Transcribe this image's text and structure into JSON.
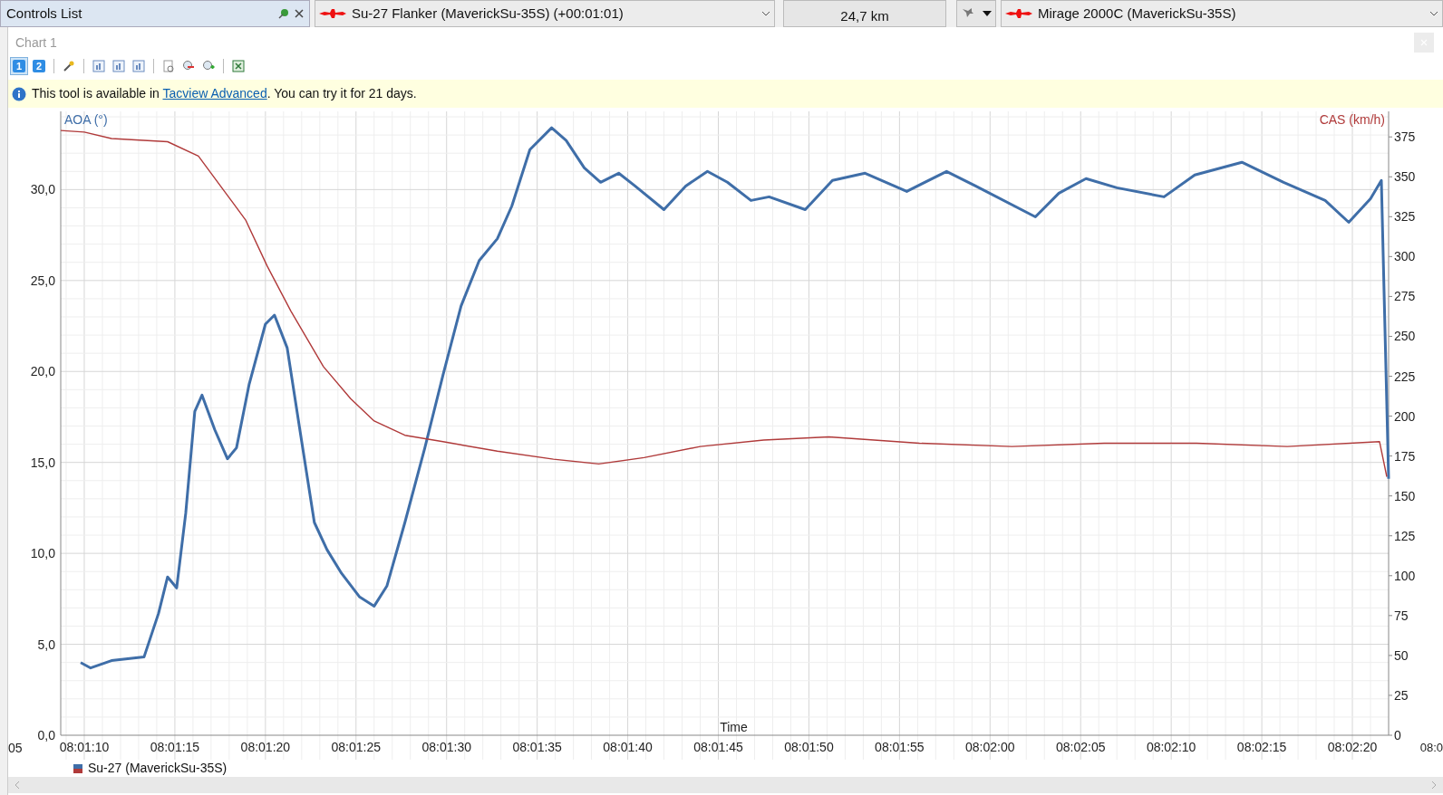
{
  "top_bar": {
    "panel_title": "Controls List",
    "primary_aircraft": "Su-27 Flanker (MaverickSu-35S) (+00:01:01)",
    "distance": "24,7 km",
    "secondary_aircraft": "Mirage 2000C (MaverickSu-35S)"
  },
  "chart_window": {
    "title": "Chart 1",
    "toolbar": [
      {
        "label": "1",
        "selected": true
      },
      {
        "label": "2",
        "selected": false
      }
    ],
    "info": {
      "before": "This tool is available in ",
      "link": "Tacview Advanced",
      "after": ". You can try it for 21 days."
    },
    "chart_data": {
      "type": "line",
      "xlabel": "Time",
      "grid": true,
      "xlim": [
        28868.7,
        28942
      ],
      "ylim": [
        0,
        34.3
      ],
      "y2lim": [
        0,
        391
      ],
      "xticks": [
        {
          "value": 28870,
          "label": "08:01:10"
        },
        {
          "value": 28875,
          "label": "08:01:15"
        },
        {
          "value": 28880,
          "label": "08:01:20"
        },
        {
          "value": 28885,
          "label": "08:01:25"
        },
        {
          "value": 28890,
          "label": "08:01:30"
        },
        {
          "value": 28895,
          "label": "08:01:35"
        },
        {
          "value": 28900,
          "label": "08:01:40"
        },
        {
          "value": 28905,
          "label": "08:01:45"
        },
        {
          "value": 28910,
          "label": "08:01:50"
        },
        {
          "value": 28915,
          "label": "08:01:55"
        },
        {
          "value": 28920,
          "label": "08:02:00"
        },
        {
          "value": 28925,
          "label": "08:02:05"
        },
        {
          "value": 28930,
          "label": "08:02:10"
        },
        {
          "value": 28935,
          "label": "08:02:15"
        },
        {
          "value": 28940,
          "label": "08:02:20"
        }
      ],
      "yticks": [
        {
          "value": 0,
          "label": "0,0"
        },
        {
          "value": 5,
          "label": "5,0"
        },
        {
          "value": 10,
          "label": "10,0"
        },
        {
          "value": 15,
          "label": "15,0"
        },
        {
          "value": 20,
          "label": "20,0"
        },
        {
          "value": 25,
          "label": "25,0"
        },
        {
          "value": 30,
          "label": "30,0"
        }
      ],
      "y2ticks": [
        0,
        25,
        50,
        75,
        100,
        125,
        150,
        175,
        200,
        225,
        250,
        275,
        300,
        325,
        350,
        375
      ],
      "series": [
        {
          "name": "AOA (°)",
          "color": "#3f6ea8",
          "x": [
            28869.8,
            28870.35,
            28871.5,
            28873.3,
            28874.1,
            28874.6,
            28875.1,
            28875.6,
            28876.1,
            28876.5,
            28877.2,
            28877.9,
            28878.4,
            28879.1,
            28880,
            28880.5,
            28881.2,
            28881.9,
            28882.7,
            28883.4,
            28884.2,
            28885.2,
            28886,
            28886.7,
            28887.7,
            28888.8,
            28889.8,
            28890.8,
            28891.8,
            28892.8,
            28893.6,
            28894.6,
            28895.8,
            28896.6,
            28897.6,
            28898.5,
            28899.5,
            28900.4,
            28902,
            28903.2,
            28904.4,
            28905.5,
            28906.8,
            28907.8,
            28909.8,
            28911.3,
            28913.1,
            28915.4,
            28917.6,
            28919.2,
            28922.5,
            28923.8,
            28925.3,
            28927,
            28929.6,
            28931.3,
            28933.9,
            28936.2,
            28938.5,
            28939.8,
            28941,
            28941.6,
            28942
          ],
          "values": [
            4.0,
            3.7,
            4.1,
            4.3,
            6.7,
            8.7,
            8.1,
            12.2,
            17.8,
            18.7,
            16.8,
            15.2,
            15.8,
            19.3,
            22.6,
            23.1,
            21.3,
            16.8,
            11.7,
            10.2,
            8.9,
            7.6,
            7.1,
            8.2,
            11.7,
            15.8,
            19.8,
            23.6,
            26.1,
            27.3,
            29.1,
            32.2,
            33.4,
            32.7,
            31.2,
            30.4,
            30.9,
            30.2,
            28.9,
            30.2,
            31.0,
            30.4,
            29.4,
            29.6,
            28.9,
            30.5,
            30.9,
            29.9,
            31.0,
            30.2,
            28.5,
            29.8,
            30.6,
            30.1,
            29.6,
            30.8,
            31.5,
            30.4,
            29.4,
            28.2,
            29.5,
            30.5,
            14.1
          ]
        },
        {
          "name": "CAS (km/h)",
          "axis": "y2",
          "color": "#b03a3a",
          "x": [
            28868.7,
            28870,
            28871.5,
            28874.6,
            28876.3,
            28877.6,
            28878.9,
            28880.1,
            28881.4,
            28883.2,
            28884.7,
            28886,
            28887.7,
            28889.8,
            28892.8,
            28895.9,
            28898.4,
            28900.9,
            28904,
            28907.5,
            28911.1,
            28916.1,
            28921.2,
            28926.3,
            28931.4,
            28936.4,
            28941.5,
            28941.9
          ],
          "values": [
            379,
            378,
            374,
            372,
            363,
            343,
            323,
            294,
            266,
            231,
            211,
            197,
            188,
            184,
            178,
            173,
            170,
            174,
            181,
            185,
            187,
            183,
            181,
            183,
            183,
            181,
            184,
            162
          ]
        }
      ]
    },
    "cut_tick_labels": [
      "05",
      "08:0"
    ],
    "legend": {
      "label": "Su-27 (MaverickSu-35S)"
    }
  }
}
